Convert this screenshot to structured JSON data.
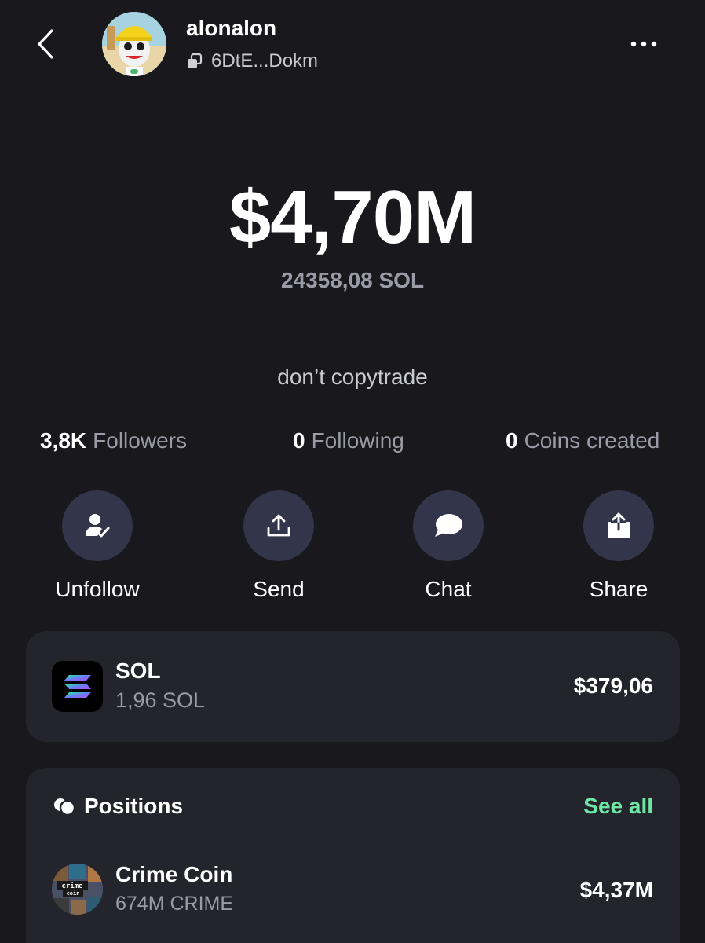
{
  "header": {
    "username": "alonalon",
    "address": "6DtE...Dokm"
  },
  "balance": {
    "usd": "$4,70M",
    "sol": "24358,08 SOL"
  },
  "bio": "don’t copytrade",
  "stats": {
    "followers": {
      "count": "3,8K",
      "label": "Followers"
    },
    "following": {
      "count": "0",
      "label": "Following"
    },
    "coins_created": {
      "count": "0",
      "label": "Coins created"
    }
  },
  "actions": {
    "unfollow": "Unfollow",
    "send": "Send",
    "chat": "Chat",
    "share": "Share"
  },
  "sol_holding": {
    "name": "SOL",
    "amount": "1,96 SOL",
    "value": "$379,06"
  },
  "positions": {
    "title": "Positions",
    "see_all": "See all",
    "items": [
      {
        "name": "Crime Coin",
        "amount": "674M CRIME",
        "value": "$4,37M",
        "logo_text": "crime coin"
      }
    ]
  },
  "colors": {
    "background": "#18181d",
    "card": "#23242c",
    "action_circle": "#33364a",
    "accent_green": "#6ee7a5",
    "muted_text": "#9a9ba6"
  }
}
